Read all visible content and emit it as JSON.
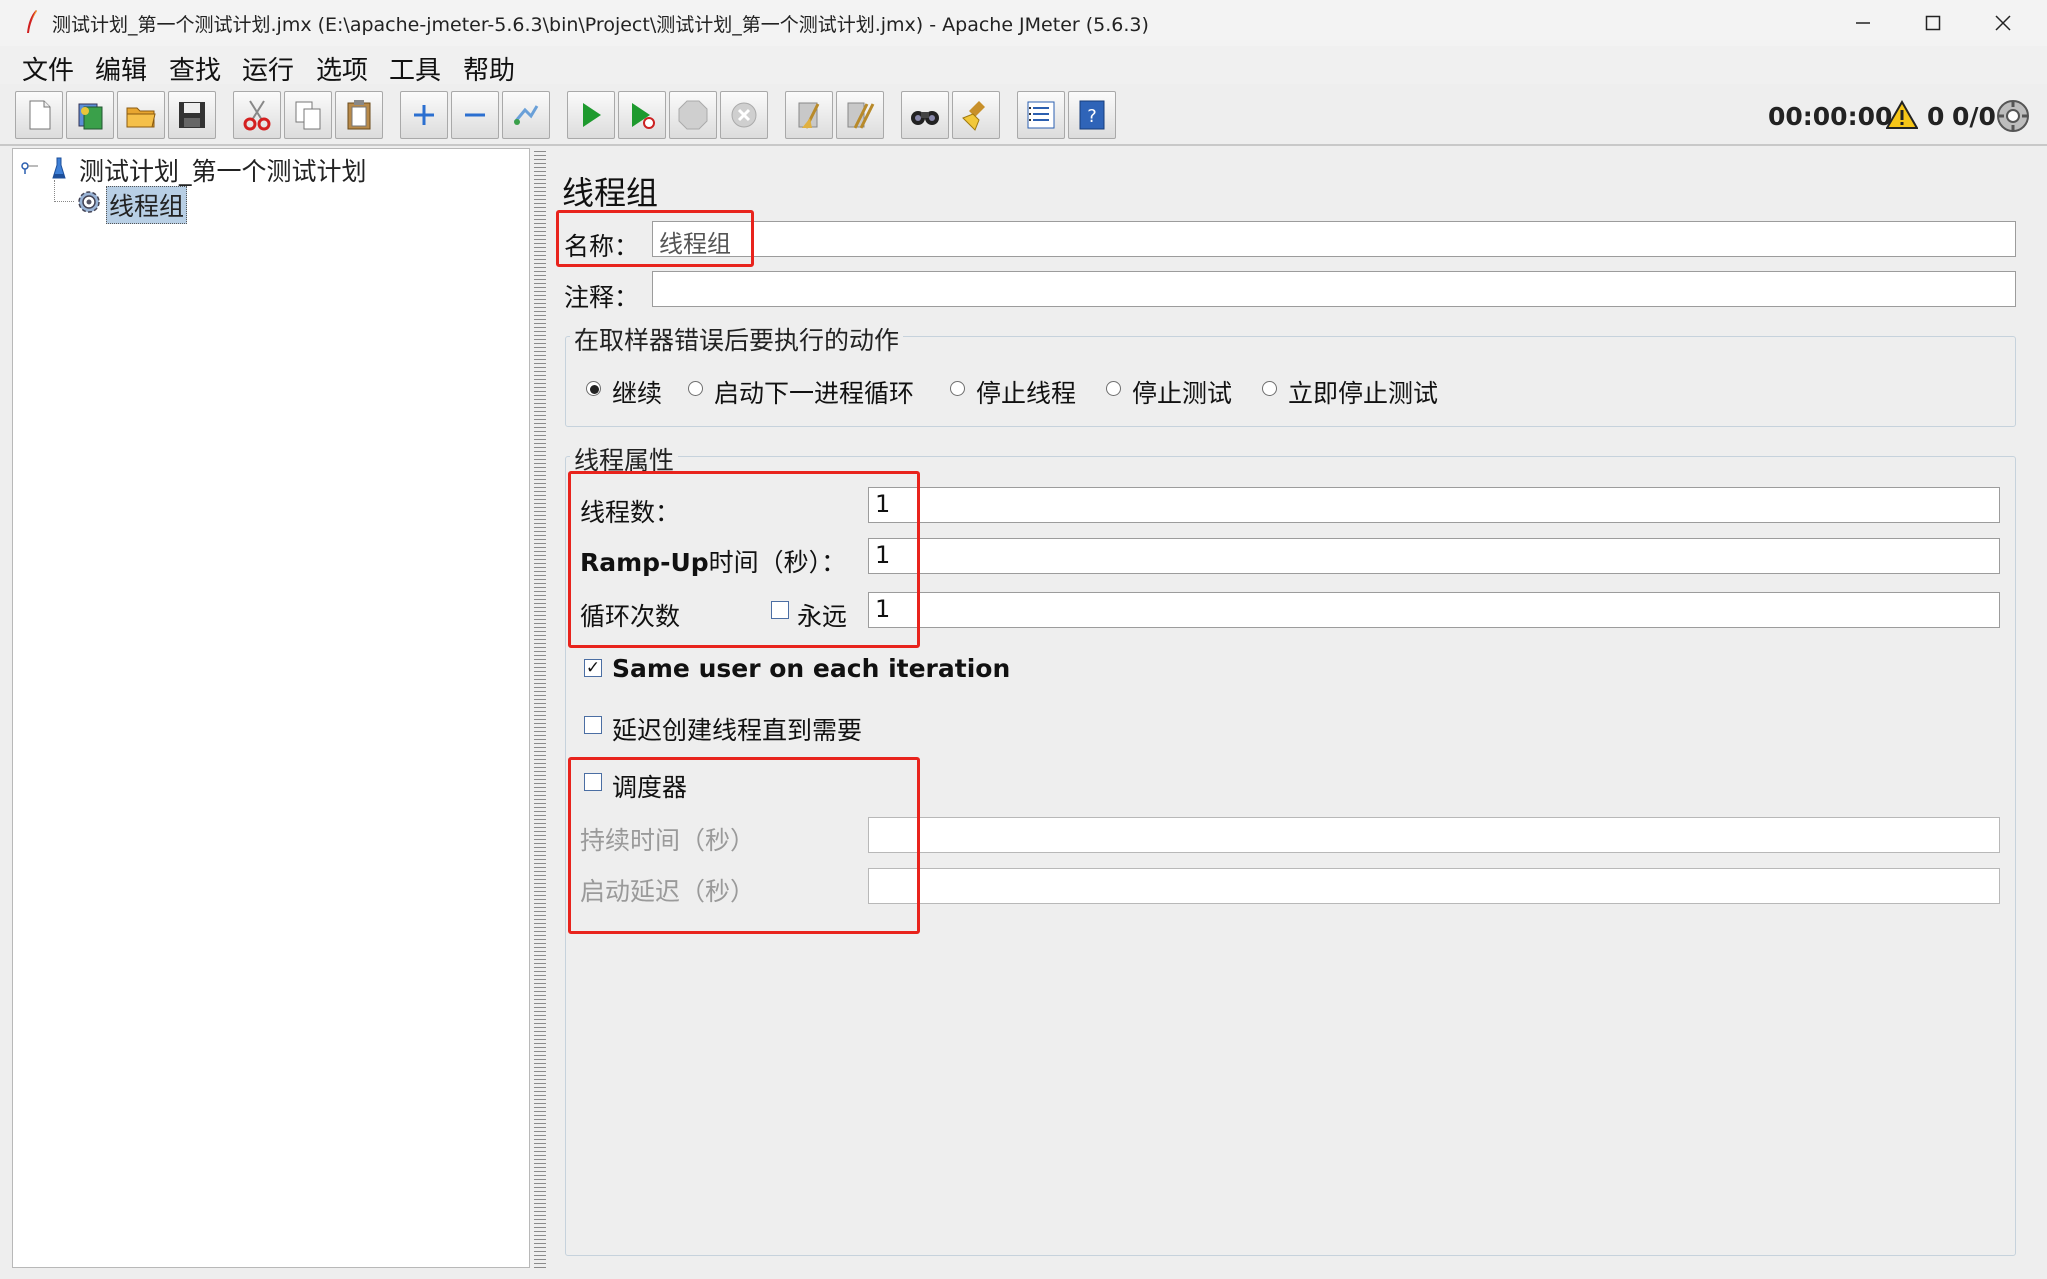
{
  "window": {
    "title": "测试计划_第一个测试计划.jmx (E:\\apache-jmeter-5.6.3\\bin\\Project\\测试计划_第一个测试计划.jmx) - Apache JMeter (5.6.3)",
    "controls": [
      "minimize-icon",
      "maximize-icon",
      "close-icon"
    ]
  },
  "menu": [
    "文件",
    "编辑",
    "查找",
    "运行",
    "选项",
    "工具",
    "帮助"
  ],
  "toolbar": {
    "buttons": [
      "new-icon",
      "templates-icon",
      "open-icon",
      "save-icon",
      "cut-icon",
      "copy-icon",
      "paste-icon",
      "expand-icon",
      "collapse-icon",
      "toggle-icon",
      "start-icon",
      "start-no-pause-icon",
      "stop-icon",
      "shutdown-icon",
      "clear-icon",
      "clear-all-icon",
      "search-icon",
      "reset-search-icon",
      "function-helper-icon",
      "help-icon"
    ],
    "timer": "00:00:00",
    "warnings": "0",
    "threads": "0/0"
  },
  "tree": {
    "root": "测试计划_第一个测试计划",
    "child": "线程组"
  },
  "panel": {
    "title": "线程组",
    "name_label": "名称：",
    "name_value": "线程组",
    "comment_label": "注释：",
    "comment_value": "",
    "error_action": {
      "legend": "在取样器错误后要执行的动作",
      "options": [
        "继续",
        "启动下一进程循环",
        "停止线程",
        "停止测试",
        "立即停止测试"
      ],
      "selected": "继续"
    },
    "thread_props": {
      "legend": "线程属性",
      "threads_label": "线程数：",
      "threads_value": "1",
      "rampup_label_bold": "Ramp-Up",
      "rampup_label_rest": "时间（秒）：",
      "rampup_value": "1",
      "loop_label": "循环次数",
      "forever_label": "永远",
      "forever_checked": false,
      "loop_value": "1",
      "same_user_label": "Same user on each iteration",
      "same_user_checked": true,
      "delay_label": "延迟创建线程直到需要",
      "delay_checked": false,
      "scheduler_label": "调度器",
      "scheduler_checked": false,
      "duration_label": "持续时间（秒）",
      "duration_value": "",
      "startup_delay_label": "启动延迟（秒）",
      "startup_delay_value": ""
    }
  },
  "colors": {
    "highlight": "#e8231c",
    "selection": "#b8cfe5"
  }
}
